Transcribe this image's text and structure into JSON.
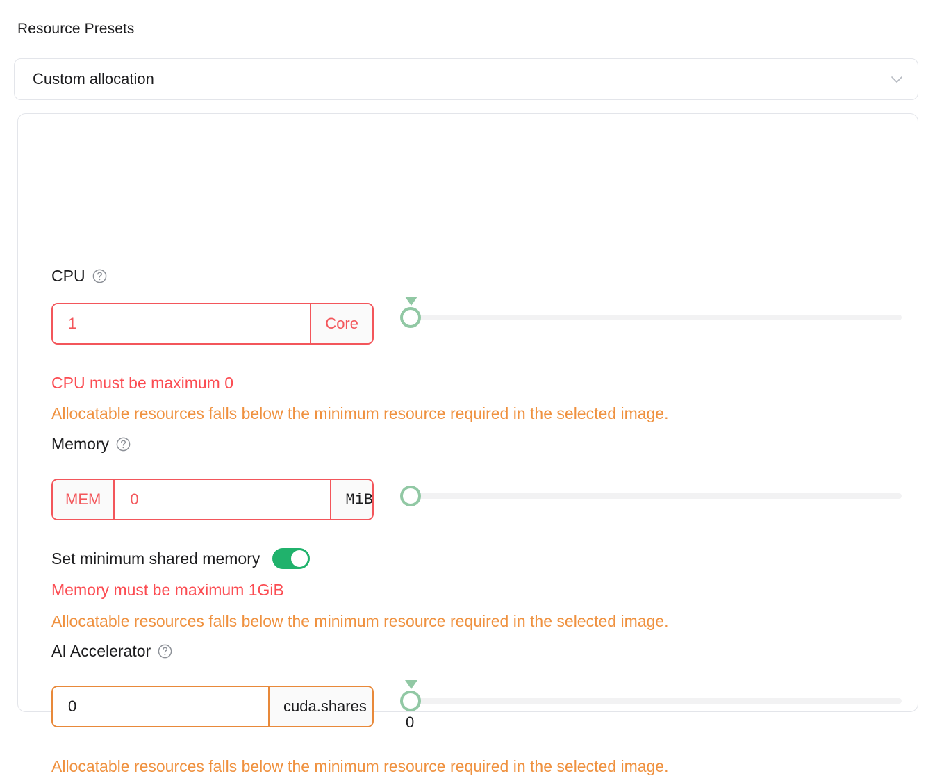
{
  "presets": {
    "label": "Resource Presets",
    "selected": "Custom allocation",
    "chevron_icon": "chevron-down-icon"
  },
  "colors": {
    "error_red": "#fb4c52",
    "warning_orange": "#ef913f",
    "input_error_border": "#f3565b",
    "input_warning_border": "#e8893a",
    "slider_green": "#91c8a4",
    "toggle_on_green": "#20b26c",
    "card_border": "#e3e5ea",
    "text_dark": "#1c1c1e"
  },
  "cpu": {
    "label": "CPU",
    "help_icon": "help-circle-icon",
    "value": "1",
    "unit": "Core",
    "slider": {
      "value": "",
      "has_marker": true
    },
    "error_message": "CPU must be maximum 0",
    "warning_message": "Allocatable resources falls below the minimum resource required in the selected image."
  },
  "memory": {
    "label": "Memory",
    "help_icon": "help-circle-icon",
    "prefix": "MEM",
    "value": "0",
    "unit": "MiB",
    "unit_chevron_icon": "chevron-down-icon",
    "slider": {
      "value": "",
      "has_marker": false
    },
    "shared_memory_toggle": {
      "label": "Set minimum shared memory",
      "state": "on"
    },
    "error_message": "Memory must be maximum 1GiB",
    "warning_message": "Allocatable resources falls below the minimum resource required in the selected image."
  },
  "accelerator": {
    "label": "AI Accelerator",
    "help_icon": "help-circle-icon",
    "value": "0",
    "unit": "cuda.shares",
    "slider": {
      "value": "0",
      "has_marker": true
    },
    "warning_message": "Allocatable resources falls below the minimum resource required in the selected image."
  }
}
